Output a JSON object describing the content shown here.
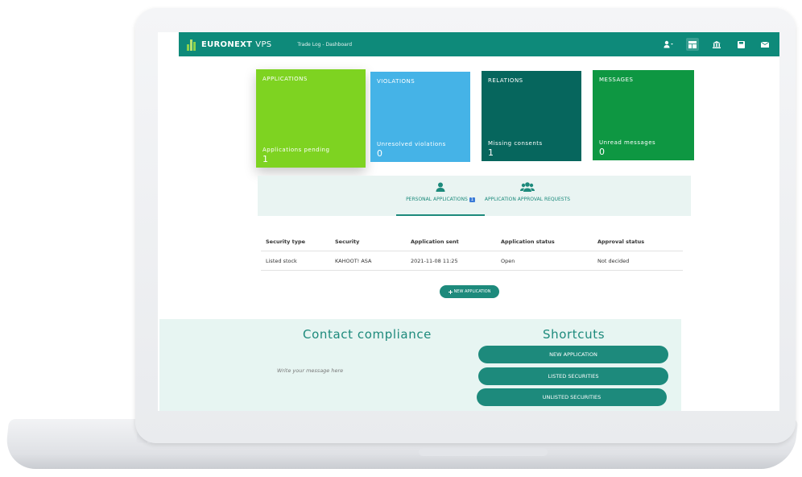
{
  "app": {
    "brand": "EURONEXT",
    "brand_suffix": "VPS",
    "breadcrumb": "Trade Log - Dashboard",
    "colors": {
      "primary": "#0e8a7a",
      "green": "#7ed321",
      "blue": "#45b3e7",
      "dark_teal": "#06665d",
      "emerald": "#0e9742"
    }
  },
  "header": {
    "icons": [
      "user-icon",
      "dashboard-icon",
      "bank-icon",
      "save-icon",
      "mail-icon"
    ]
  },
  "cards": {
    "applications": {
      "title": "APPLICATIONS",
      "subtitle": "Applications pending",
      "count": "1"
    },
    "violations": {
      "title": "VIOLATIONS",
      "subtitle": "Unresolved violations",
      "count": "0"
    },
    "relations": {
      "title": "RELATIONS",
      "subtitle": "Missing consents",
      "count": "1"
    },
    "messages": {
      "title": "MESSAGES",
      "subtitle": "Unread messages",
      "count": "0"
    }
  },
  "tabs": {
    "personal": {
      "label": "PERSONAL APPLICATIONS",
      "badge": "1"
    },
    "approval": {
      "label": "APPLICATION APPROVAL REQUESTS"
    }
  },
  "table": {
    "headers": [
      "Security type",
      "Security",
      "Application sent",
      "Application status",
      "Approval status"
    ],
    "rows": [
      [
        "Listed stock",
        "KAHOOT! ASA",
        "2021-11-08 11:25",
        "Open",
        "Not decided"
      ]
    ]
  },
  "new_application_button": "NEW APPLICATION",
  "contact": {
    "title": "Contact compliance",
    "placeholder": "Write your message here"
  },
  "shortcuts": {
    "title": "Shortcuts",
    "items": [
      "NEW APPLICATION",
      "LISTED SECURITIES",
      "UNLISTED SECURITIES"
    ]
  }
}
